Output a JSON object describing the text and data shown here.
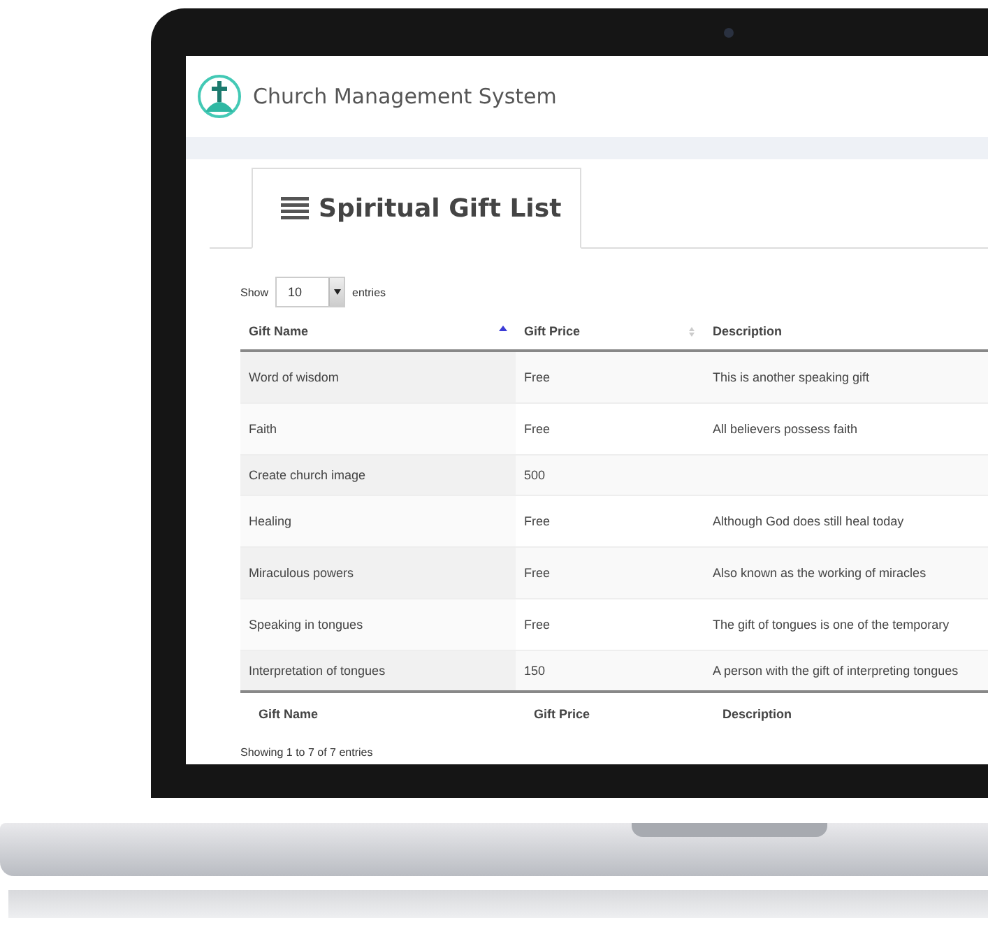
{
  "app": {
    "title": "Church Management System"
  },
  "panel": {
    "tab_label": "Spiritual Gift List"
  },
  "length_menu": {
    "before": "Show",
    "value": "10",
    "after": "entries"
  },
  "table": {
    "columns": [
      {
        "label": "Gift Name",
        "sorted": true
      },
      {
        "label": "Gift Price",
        "sorted": false
      },
      {
        "label": "Description"
      }
    ],
    "rows": [
      [
        "Word of wisdom",
        "Free",
        "This is another speaking gift"
      ],
      [
        "Faith",
        "Free",
        "All believers possess faith"
      ],
      [
        "Create church image",
        "500",
        ""
      ],
      [
        "Healing",
        "Free",
        "Although God does still heal today"
      ],
      [
        "Miraculous powers",
        "Free",
        "Also known as the working of miracles"
      ],
      [
        "Speaking in tongues",
        "Free",
        "The gift of tongues is one of the temporary"
      ],
      [
        "Interpretation of tongues",
        "150",
        "A person with the gift of interpreting tongues"
      ]
    ],
    "footer": [
      "Gift Name",
      "Gift Price",
      "Description"
    ]
  },
  "info": "Showing 1 to 7 of 7 entries"
}
